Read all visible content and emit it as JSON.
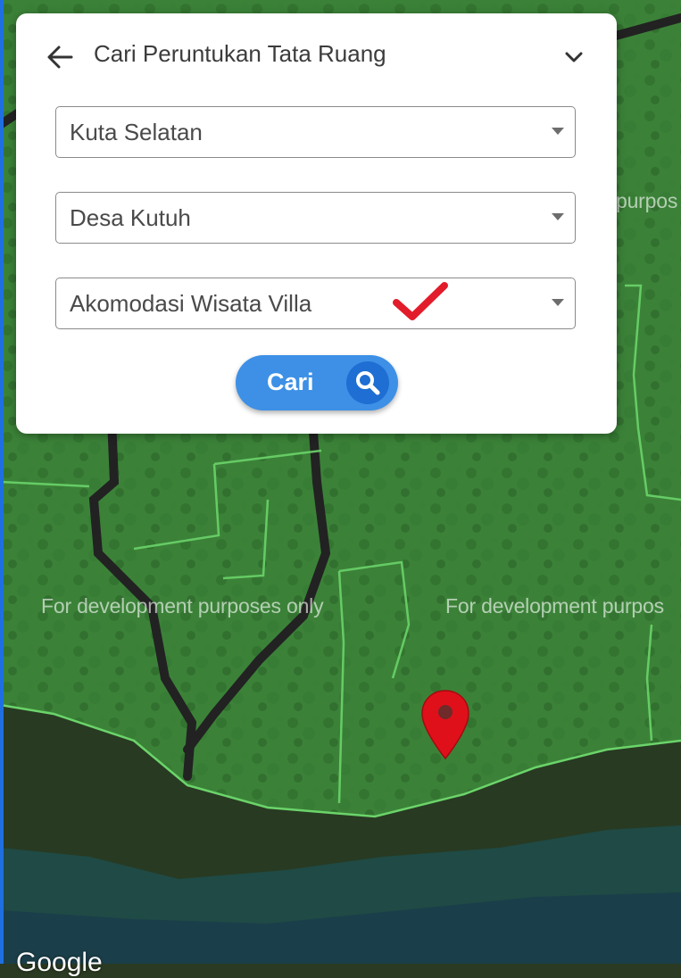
{
  "map": {
    "watermark_text": "For development purposes only",
    "watermark_partial_top": "purpos",
    "watermark_partial_right": "For development purpos",
    "attribution_logo": "Google",
    "marker_icon": "map-pin-icon",
    "overlay_color": "#3f9a3c"
  },
  "panel": {
    "title": "Cari Peruntukan Tata Ruang",
    "back_icon": "arrow-left-icon",
    "collapse_icon": "chevron-down-icon",
    "district_select": {
      "value": "Kuta Selatan"
    },
    "village_select": {
      "value": "Desa Kutuh"
    },
    "zoning_select": {
      "value": "Akomodasi Wisata Villa",
      "annotation_icon": "checkmark-icon"
    },
    "search_button": {
      "label": "Cari",
      "icon": "search-icon",
      "color": "#3d90e6"
    }
  }
}
